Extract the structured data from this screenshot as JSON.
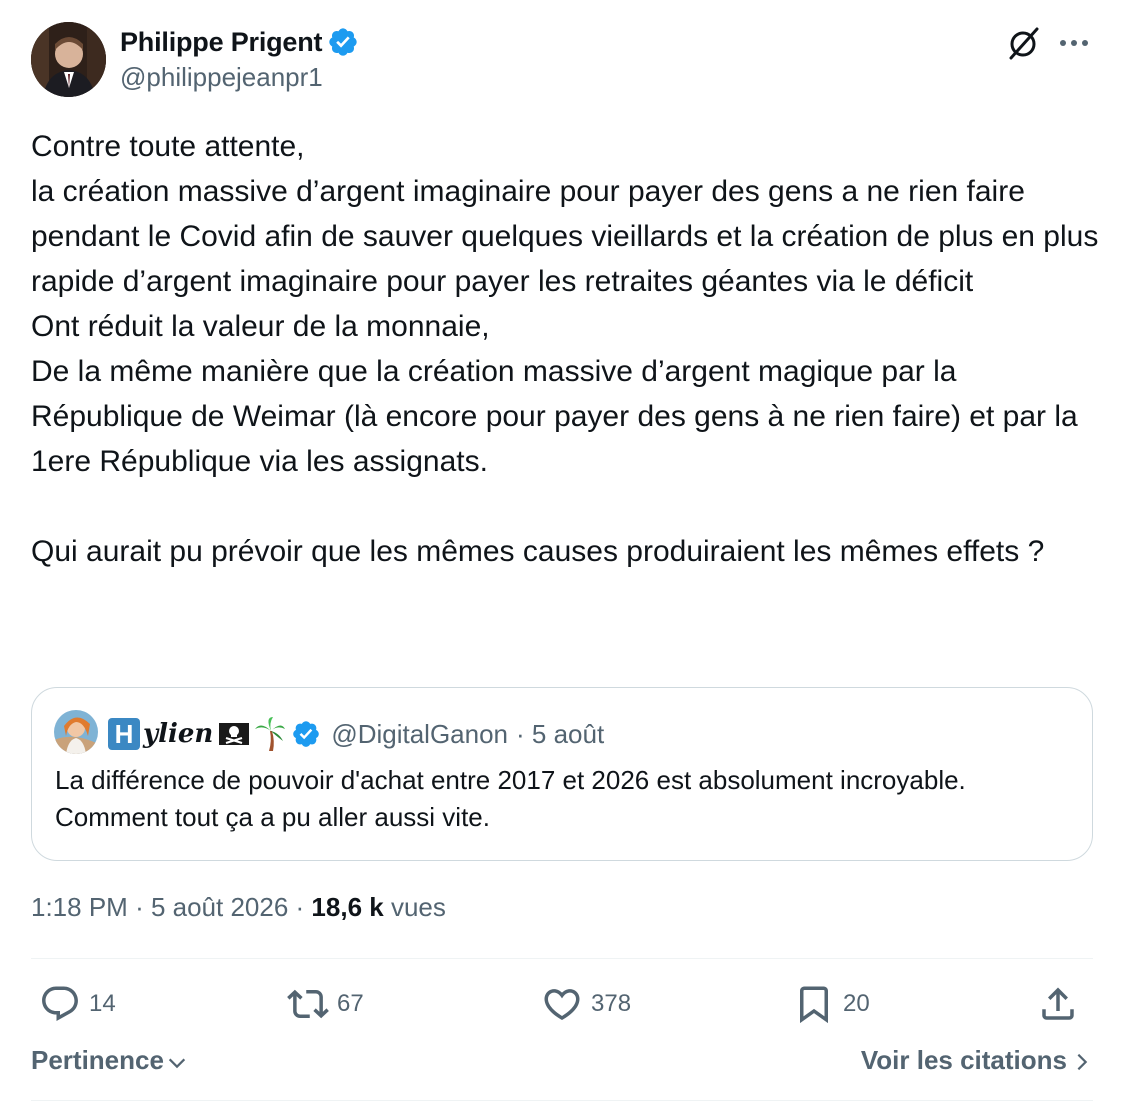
{
  "author": {
    "display_name": "Philippe Prigent",
    "handle": "@philippejeanpr1",
    "verified": true
  },
  "tweet": {
    "text": "Contre toute attente,\nla création massive d’argent imaginaire pour payer des gens a ne rien faire pendant le Covid afin de sauver quelques vieillards et la création de plus en plus rapide d’argent imaginaire pour payer les retraites géantes via le déficit\nOnt réduit la valeur de la monnaie,\nDe la même manière que la création massive d’argent magique par la République de Weimar (là encore pour payer des gens à ne rien faire) et par la 1ere République via les assignats.\n\nQui aurait pu prévoir que les mêmes causes produiraient les mêmes effets ?"
  },
  "quote": {
    "name_initial": "H",
    "name_rest": "ylien",
    "handle": "@DigitalGanon",
    "date": "· 5 août",
    "text": "La différence de pouvoir d'achat entre 2017 et 2026 est absolument incroyable. Comment tout ça a pu aller aussi vite."
  },
  "meta": {
    "time": "1:18 PM",
    "date": "· 5 août 2026 ·",
    "views_count": "18,6 k",
    "views_label": "vues"
  },
  "actions": {
    "replies": "14",
    "reposts": "67",
    "likes": "378",
    "bookmarks": "20"
  },
  "footer": {
    "sort_label": "Pertinence",
    "quotes_label": "Voir les citations"
  },
  "colors": {
    "text": "#0f1419",
    "secondary": "#536471",
    "verified": "#1d9bf0",
    "border": "#cfd9de"
  },
  "icons": [
    "reply-icon",
    "repost-icon",
    "like-icon",
    "bookmark-icon",
    "share-icon",
    "grok-icon",
    "more-icon",
    "verified-icon",
    "chevron-down-icon",
    "chevron-right-icon"
  ]
}
